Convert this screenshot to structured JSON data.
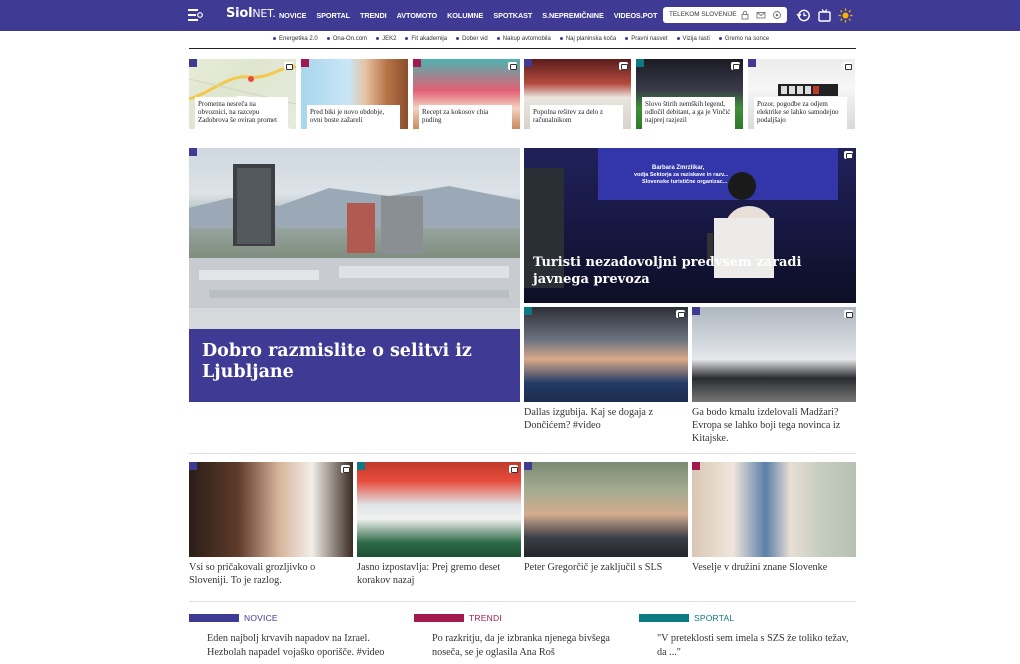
{
  "header": {
    "logo_main": "Siol",
    "logo_suffix": "NET.",
    "nav": [
      "NOVICE",
      "SPORTAL",
      "TRENDI",
      "AVTOMOTO",
      "KOLUMNE",
      "SPOTKAST",
      "S.NEPREMIČNINE",
      "VIDEOS.POT"
    ],
    "search_label": "TELEKOM SLOVENIJE"
  },
  "topics": [
    "Energetika 2.0",
    "Ona-On.com",
    "JEK2",
    "Fit akademija",
    "Dober vid",
    "Nakup avtomobila",
    "Naj planinska koča",
    "Pravni nasvet",
    "Vizija rasti",
    "Gremo na sonce"
  ],
  "thumbs": [
    {
      "caption": "Prometna nesreča na obvoznici, na razcepu Zadobrova še oviran promet",
      "accent": "#3f3a94"
    },
    {
      "caption": "Pred biki je novo obdobje, ovni boste zažareli",
      "accent": "#a21950"
    },
    {
      "caption": "Recept za kokosov chia puding",
      "accent": "#a21950"
    },
    {
      "caption": "Popolna rešitev za delo z računalnikom",
      "accent": "#3f3a94"
    },
    {
      "caption": "Slovo štirih nemških legend, odločil debitant, a ga je Vinčić najprej razjezil",
      "accent": "#0d7a83"
    },
    {
      "caption": "Pozor, pogodbe za odjem elektrike se lahko samodejno podaljšajo",
      "accent": "#3f3a94"
    }
  ],
  "feature_left": {
    "headline": "Dobro razmislite o selitvi iz Ljubljane",
    "accent": "#3f3a94"
  },
  "feature_right": {
    "headline": "Turisti nezadovoljni predvsem zaradi javnega prevoza",
    "screen_title": "Barbara Zmrzlikar,",
    "screen_sub1": "vodja Sektorja za raziskave in razv...",
    "screen_sub2": "Slovenske turistične organizac..."
  },
  "cards_mid": [
    {
      "text": "Dallas izgubija. Kaj se dogaja z Dončićem? #video",
      "accent": "#0d7a83"
    },
    {
      "text": "Ga bodo kmalu izdelovali Madžari? Evropa se lahko boji tega novinca iz Kitajske.",
      "accent": "#3f3a94"
    }
  ],
  "cards_row": [
    {
      "text": "Vsi so pričakovali grozljivko o Sloveniji. To je razlog.",
      "accent": "#3f3a94"
    },
    {
      "text": "Jasno izpostavlja: Prej gremo deset korakov nazaj",
      "accent": "#0d7a83"
    },
    {
      "text": "Peter Gregorčič je zaključil s SLS",
      "accent": "#3f3a94"
    },
    {
      "text": "Veselje v družini znane Slovenke",
      "accent": "#a21950"
    }
  ],
  "sections": [
    {
      "title": "NOVICE",
      "story": "Eden najbolj krvavih napadov na Izrael. Hezbolah napadel vojaško oporišče. #video",
      "color": "#3f3a94"
    },
    {
      "title": "TRENDI",
      "story": "Po razkritju, da je izbranka njenega bivšega noseča, se je oglasila Ana Roš",
      "color": "#a21950"
    },
    {
      "title": "SPORTAL",
      "story": "\"V preteklosti sem imela s SZS že toliko težav, da ...\"",
      "color": "#0d7a83"
    }
  ]
}
